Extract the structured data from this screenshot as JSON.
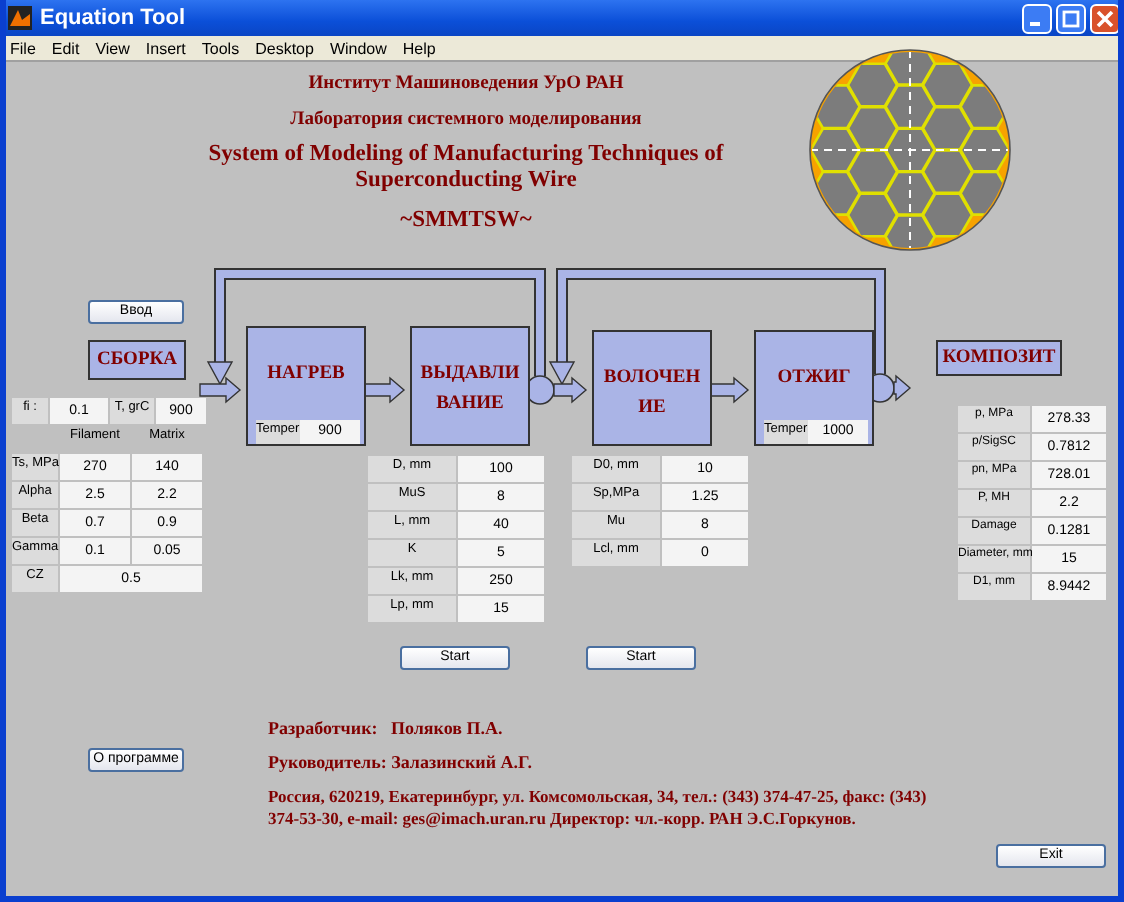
{
  "window": {
    "title": "Equation Tool"
  },
  "menu": [
    "File",
    "Edit",
    "View",
    "Insert",
    "Tools",
    "Desktop",
    "Window",
    "Help"
  ],
  "header": {
    "institute": "Институт Машиноведения УрО РАН",
    "lab": "Лаборатория системного моделирования",
    "title": "System of Modeling of Manufacturing Techniques of Superconducting Wire",
    "acronym": "~SMMTSW~"
  },
  "input_button": "Ввод",
  "assembly": {
    "label": "СБОРКА",
    "fi_label": "fi :",
    "fi": "0.1",
    "t_label": "T, grC",
    "t": "900",
    "columns": [
      "Filament",
      "Matrix"
    ],
    "rows": [
      {
        "label": "Ts, MPa",
        "filament": "270",
        "matrix": "140"
      },
      {
        "label": "Alpha",
        "filament": "2.5",
        "matrix": "2.2"
      },
      {
        "label": "Beta",
        "filament": "0.7",
        "matrix": "0.9"
      },
      {
        "label": "Gamma",
        "filament": "0.1",
        "matrix": "0.05"
      }
    ],
    "cz": {
      "label": "CZ",
      "value": "0.5"
    }
  },
  "stages": [
    {
      "kind": "temper",
      "label": "НАГРЕВ",
      "temper_label": "Temper",
      "temper": "900"
    },
    {
      "kind": "params",
      "label": "ВЫДАВЛИВАНИЕ",
      "params": [
        {
          "label": "D, mm",
          "value": "100"
        },
        {
          "label": "MuS",
          "value": "8"
        },
        {
          "label": "L, mm",
          "value": "40"
        },
        {
          "label": "K",
          "value": "5"
        },
        {
          "label": "Lk, mm",
          "value": "250"
        },
        {
          "label": "Lp, mm",
          "value": "15"
        }
      ]
    },
    {
      "kind": "params",
      "label": "ВОЛОЧЕНИЕ",
      "params": [
        {
          "label": "D0, mm",
          "value": "10"
        },
        {
          "label": "Sp,MPa",
          "value": "1.25"
        },
        {
          "label": "Mu",
          "value": "8"
        },
        {
          "label": "Lcl, mm",
          "value": "0"
        }
      ]
    },
    {
      "kind": "temper",
      "label": "ОТЖИГ",
      "temper_label": "Temper",
      "temper": "1000"
    }
  ],
  "output": {
    "label": "КОМПОЗИТ",
    "results": [
      {
        "label": "p, MPa",
        "value": "278.33"
      },
      {
        "label": "p/SigSC",
        "value": "0.7812"
      },
      {
        "label": "pn, MPa",
        "value": "728.01"
      },
      {
        "label": "P, MH",
        "value": "2.2"
      },
      {
        "label": "Damage",
        "value": "0.1281"
      },
      {
        "label": "Diameter, mm",
        "value": "15"
      },
      {
        "label": "D1, mm",
        "value": "8.9442"
      }
    ]
  },
  "start_buttons": [
    "Start",
    "Start"
  ],
  "about_button": "О программе",
  "credits": {
    "developer": "Разработчик:   Поляков П.А.",
    "supervisor": "Руководитель: Залазинский А.Г.",
    "address": "Россия, 620219, Екатеринбург, ул. Комсомольская, 34, тел.: (343) 374-47-25, факс: (343) 374-53-30,  e-mail: ges@imach.uran.ru Директор: чл.-корр. РАН Э.С.Горкунов."
  },
  "exit_button": "Exit"
}
